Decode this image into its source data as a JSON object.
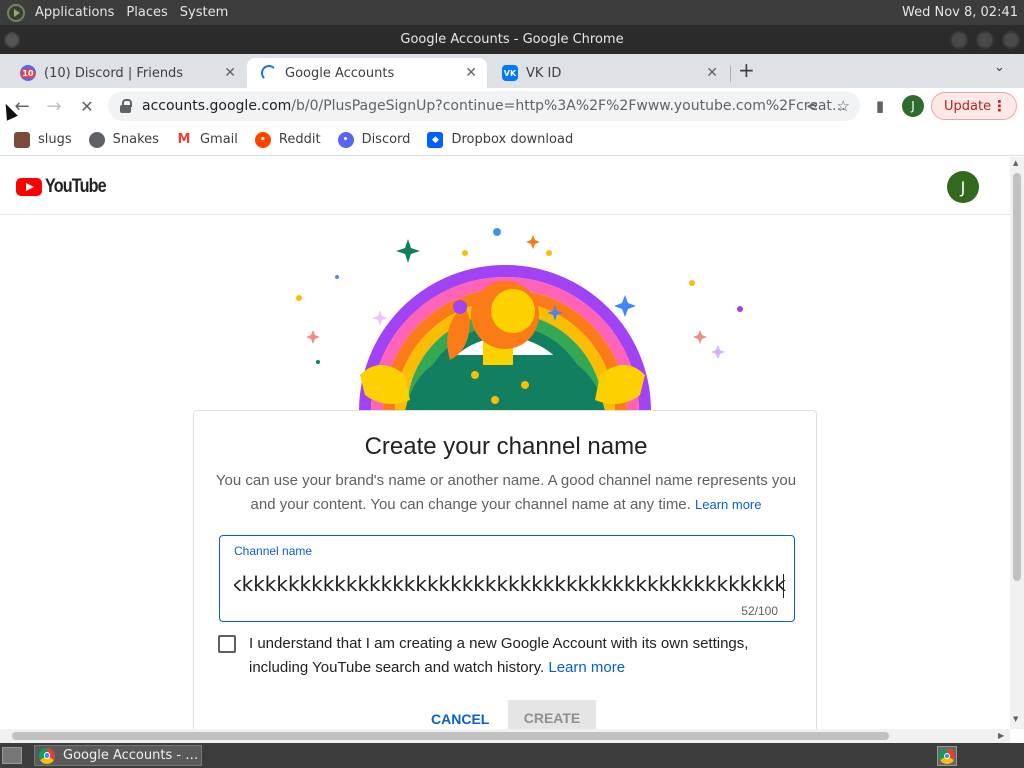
{
  "top_panel": {
    "menus": [
      "Applications",
      "Places",
      "System"
    ],
    "clock": "Wed Nov 8, 02:41"
  },
  "window": {
    "title": "Google Accounts - Google Chrome"
  },
  "tabs": [
    {
      "label": "(10) Discord | Friends",
      "badge": "10",
      "icon": "discord-icon"
    },
    {
      "label": "Google Accounts",
      "icon": "loading-spinner-icon",
      "active": true
    },
    {
      "label": "VK ID",
      "icon": "vk-icon"
    }
  ],
  "toolbar": {
    "url_host": "accounts.google.com",
    "url_path": "/b/0/PlusPageSignUp?continue=http%3A%2F%2Fwww.youtube.com%2Fcreat…",
    "profile_initial": "J",
    "update_label": "Update"
  },
  "bookmarks": [
    {
      "label": "slugs",
      "icon": "slug-icon",
      "color": "#7a4b3a"
    },
    {
      "label": "Snakes",
      "icon": "globe-icon",
      "color": "#5f6368"
    },
    {
      "label": "Gmail",
      "icon": "gmail-icon",
      "color": "#ea4335"
    },
    {
      "label": "Reddit",
      "icon": "reddit-icon",
      "color": "#ff4500"
    },
    {
      "label": "Discord",
      "icon": "discord-icon",
      "color": "#5865f2"
    },
    {
      "label": "Dropbox download",
      "icon": "dropbox-icon",
      "color": "#0061ff"
    }
  ],
  "page": {
    "brand": "YouTube",
    "avatar_initial": "J",
    "card": {
      "title": "Create your channel name",
      "description": "You can use your brand's name or another name. A good channel name represents you and your content. You can change your channel name at any time.",
      "description_link": "Learn more",
      "field_label": "Channel name",
      "field_value": "kkkkkkkkkkkkkkkkkkkkkkkkkkkkkkkkkkkkkkkkkkkkkkkkkkkk",
      "char_count": "52/100",
      "consent_text": "I understand that I am creating a new Google Account with its own settings, including YouTube search and watch history.",
      "consent_link": "Learn more",
      "consent_checked": false,
      "cancel_label": "CANCEL",
      "create_label": "CREATE"
    }
  },
  "taskbar": {
    "task_label": "Google Accounts - …"
  },
  "colors": {
    "accent": "#065fd4",
    "youtube_red": "#ff0000",
    "avatar_green": "#33691e",
    "update_red": "#b3261e"
  }
}
